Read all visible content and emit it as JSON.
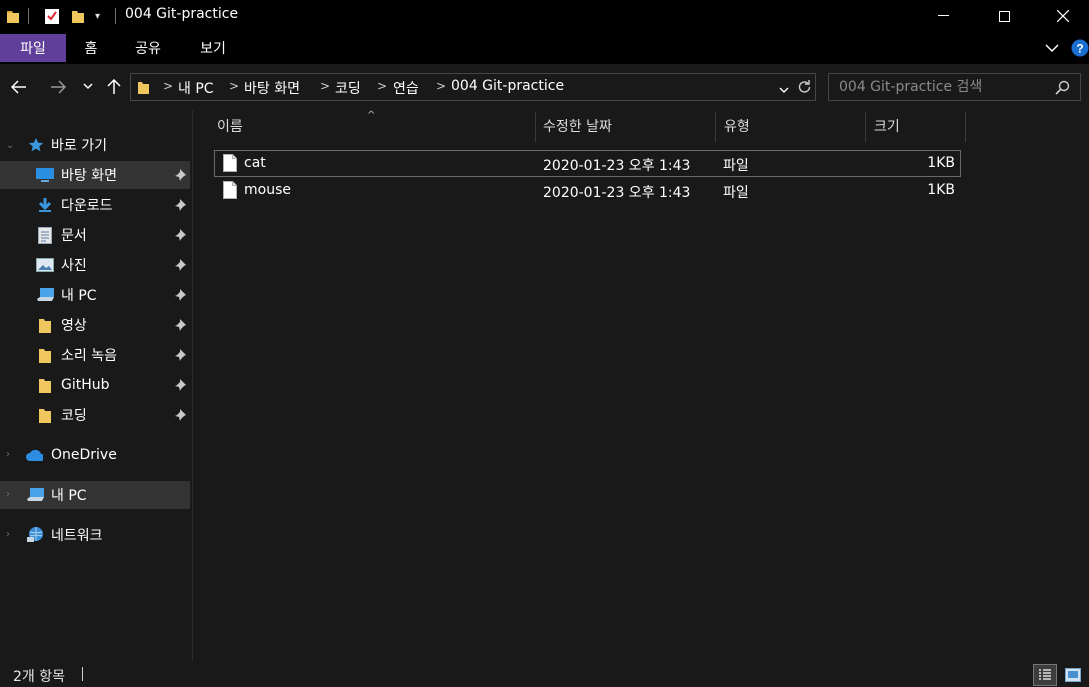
{
  "window": {
    "title": "004 Git-practice",
    "minimize_icon": "minimize-icon",
    "maximize_icon": "maximize-icon",
    "close_icon": "close-icon"
  },
  "ribbon": {
    "tabs": [
      {
        "label": "파일",
        "active": true
      },
      {
        "label": "홈"
      },
      {
        "label": "공유"
      },
      {
        "label": "보기"
      }
    ]
  },
  "address": {
    "breadcrumbs": [
      "내 PC",
      "바탕 화면",
      "코딩",
      "연습",
      "004 Git-practice"
    ]
  },
  "search": {
    "placeholder": "004 Git-practice 검색"
  },
  "nav": {
    "quick_access": "바로 가기",
    "pinned": [
      {
        "label": "바탕 화면",
        "icon": "desktop-icon",
        "selected": true
      },
      {
        "label": "다운로드",
        "icon": "download-icon"
      },
      {
        "label": "문서",
        "icon": "document-icon"
      },
      {
        "label": "사진",
        "icon": "picture-icon"
      },
      {
        "label": "내 PC",
        "icon": "pc-icon"
      },
      {
        "label": "영상",
        "icon": "folder-icon"
      },
      {
        "label": "소리 녹음",
        "icon": "folder-icon"
      },
      {
        "label": "GitHub",
        "icon": "folder-icon"
      },
      {
        "label": "코딩",
        "icon": "folder-icon"
      }
    ],
    "onedrive": "OneDrive",
    "this_pc": "내 PC",
    "network": "네트워크"
  },
  "columns": {
    "name": "이름",
    "modified": "수정한 날짜",
    "type": "유형",
    "size": "크기"
  },
  "files": [
    {
      "name": "cat",
      "modified": "2020-01-23 오후 1:43",
      "type": "파일",
      "size": "1KB"
    },
    {
      "name": "mouse",
      "modified": "2020-01-23 오후 1:43",
      "type": "파일",
      "size": "1KB"
    }
  ],
  "status": {
    "item_count": "2개 항목"
  },
  "colors": {
    "accent": "#5f3f99",
    "background": "#191919",
    "folder": "#f0c75e"
  }
}
